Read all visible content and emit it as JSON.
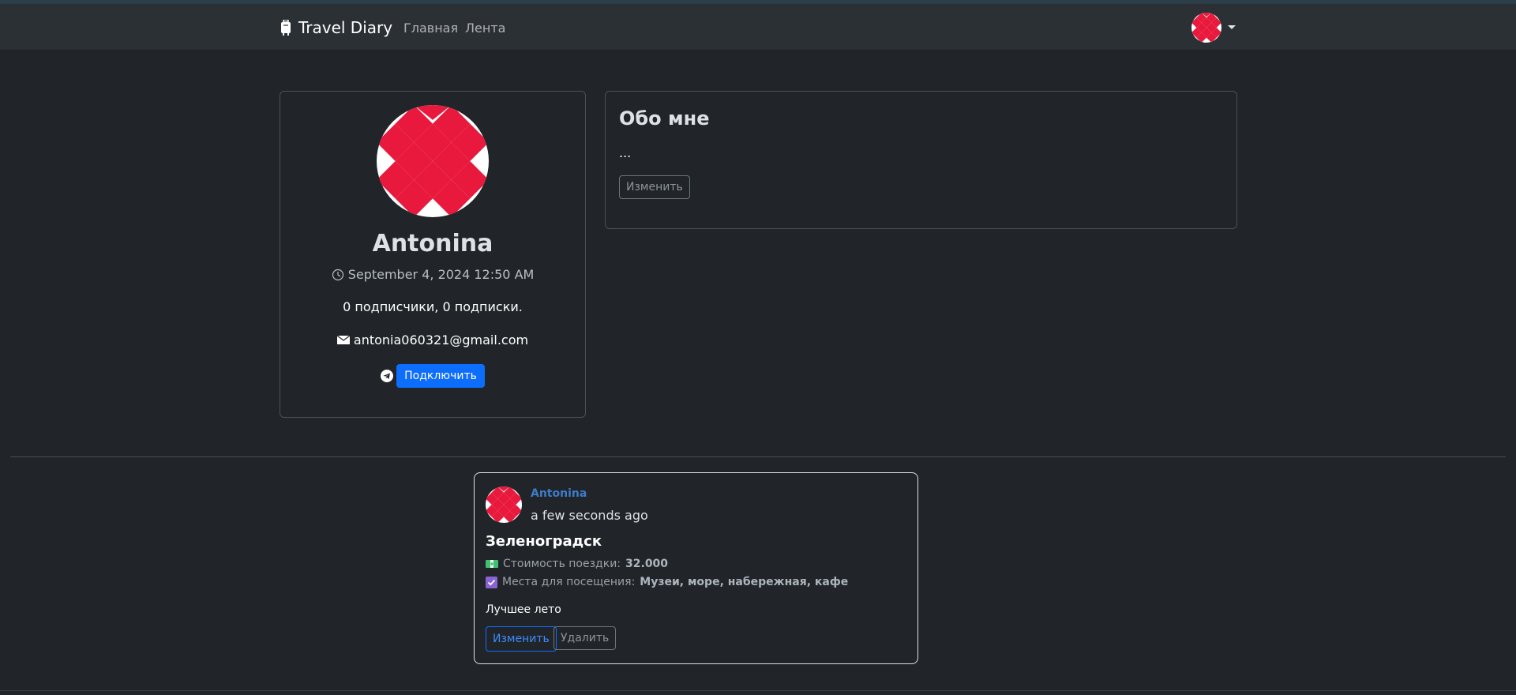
{
  "navbar": {
    "brand_name": "Travel Diary",
    "brand_icon": "suitcase-icon",
    "links": [
      "Главная",
      "Лента"
    ],
    "avatar_icon": "identicon-avatar",
    "dropdown_icon": "caret-down-icon"
  },
  "profile": {
    "name": "Antonina",
    "date": "September 4, 2024 12:50 AM",
    "followers_text": "0 подписчики, 0 подписки.",
    "email": "antonia060321@gmail.com",
    "connect_label": "Подключить",
    "icons": {
      "clock": "clock-icon",
      "email": "envelope-icon",
      "telegram": "telegram-icon"
    }
  },
  "about": {
    "title": "Обо мне",
    "text": "...",
    "edit_label": "Изменить"
  },
  "post": {
    "author": "Antonina",
    "time": "a few seconds ago",
    "title": "Зеленоградск",
    "cost_label": "Стоимость поездки:",
    "cost_value": "32.000",
    "places_label": "Места для посещения:",
    "places_value": "Музеи, море, набережная, кафе",
    "description": "Лучшее лето",
    "edit_label": "Изменить",
    "delete_label": "Удалить",
    "icons": {
      "money": "money-icon",
      "checkbox": "checkbox-icon"
    }
  },
  "colors": {
    "background": "#212529",
    "navbar": "#2b3035",
    "primary": "#0d6efd",
    "avatar_red": "#e8193c"
  }
}
